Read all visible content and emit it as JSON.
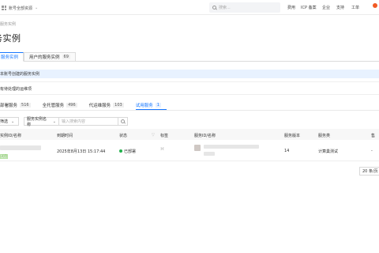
{
  "topbar": {
    "account_label": "账号全部资源",
    "search_placeholder": "搜索...",
    "nav": [
      "费用",
      "ICP 备案",
      "企业",
      "支持",
      "工单"
    ]
  },
  "breadcrumb": "服务实例",
  "page_title": "务实例",
  "main_tabs": [
    {
      "label": "服务实例",
      "count": ""
    },
    {
      "label": "用户的服务实例",
      "count": "69"
    }
  ],
  "info": {
    "banner": "本账号创建的服务实例",
    "line2": "有待处理的运维项"
  },
  "sub_tabs": [
    {
      "label": "部署服务",
      "count": "516"
    },
    {
      "label": "全托管服务",
      "count": "496"
    },
    {
      "label": "代运维服务",
      "count": "103"
    },
    {
      "label": "试用服务",
      "count": "1"
    }
  ],
  "filter": {
    "select1": "筛选",
    "select2": "服务实例名称",
    "input_placeholder": "输入搜索内容"
  },
  "table": {
    "headers": [
      "实例ID/名称",
      "到期时间",
      "状态",
      "标签",
      "服务ID/名称",
      "服务版本",
      "服务类",
      "售"
    ],
    "row": {
      "tag": "试用",
      "expiry": "2025年8月13日 15:17:44",
      "status": "已部署",
      "version": "14",
      "service_type": "计算巢测试",
      "extra": "-"
    }
  },
  "pagination": {
    "page_size": "20 条/页"
  },
  "colors": {
    "accent": "#1677ff",
    "banner_bg": "#e8f2ff",
    "status_green": "#22b14c",
    "brand_orange": "#f15a24"
  }
}
